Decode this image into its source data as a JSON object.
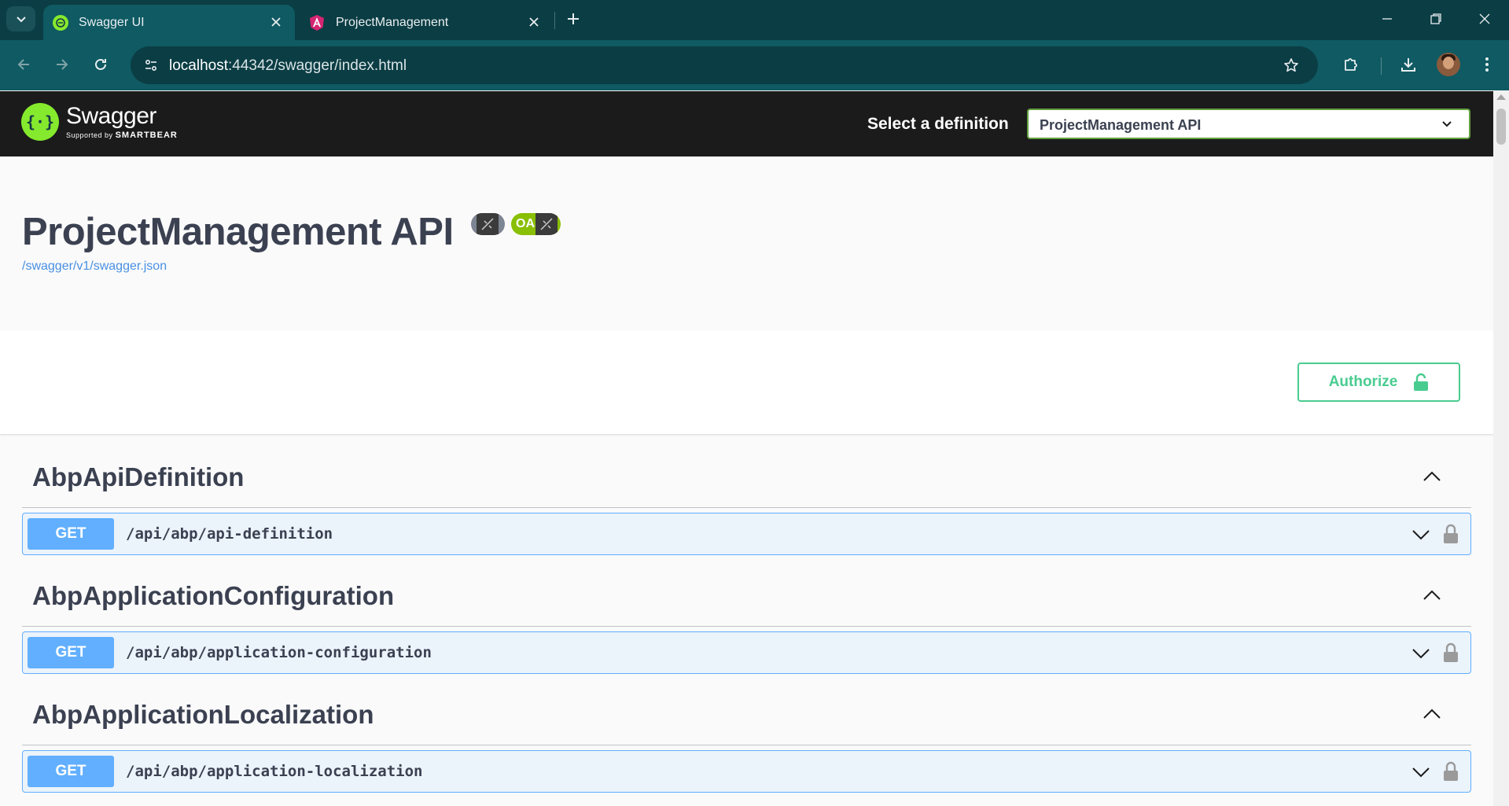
{
  "browser": {
    "tabs": [
      {
        "title": "Swagger UI",
        "icon": "swagger-favicon",
        "active": true
      },
      {
        "title": "ProjectManagement",
        "icon": "angular-favicon",
        "active": false
      }
    ],
    "url_host": "localhost",
    "url_rest": ":44342/swagger/index.html",
    "colors": {
      "frame": "#0b3d44",
      "toolbar": "#0f5a63"
    }
  },
  "swagger": {
    "logo_name": "Swagger",
    "logo_sub": "Supported by",
    "logo_brand": "SMARTBEAR",
    "select_label": "Select a definition",
    "selected_definition": "ProjectManagement API"
  },
  "info": {
    "title": "ProjectManagement API",
    "badge_oas": "OAS",
    "spec_url": "/swagger/v1/swagger.json"
  },
  "authorize": {
    "label": "Authorize",
    "color": "#49cc90"
  },
  "operations": [
    {
      "tag": "AbpApiDefinition",
      "method": "GET",
      "path": "/api/abp/api-definition"
    },
    {
      "tag": "AbpApplicationConfiguration",
      "method": "GET",
      "path": "/api/abp/application-configuration"
    },
    {
      "tag": "AbpApplicationLocalization",
      "method": "GET",
      "path": "/api/abp/application-localization"
    }
  ],
  "colors": {
    "get": "#61affe",
    "get_bg": "#ebf3fb",
    "topbar": "#1b1b1b",
    "link": "#4990e2"
  }
}
